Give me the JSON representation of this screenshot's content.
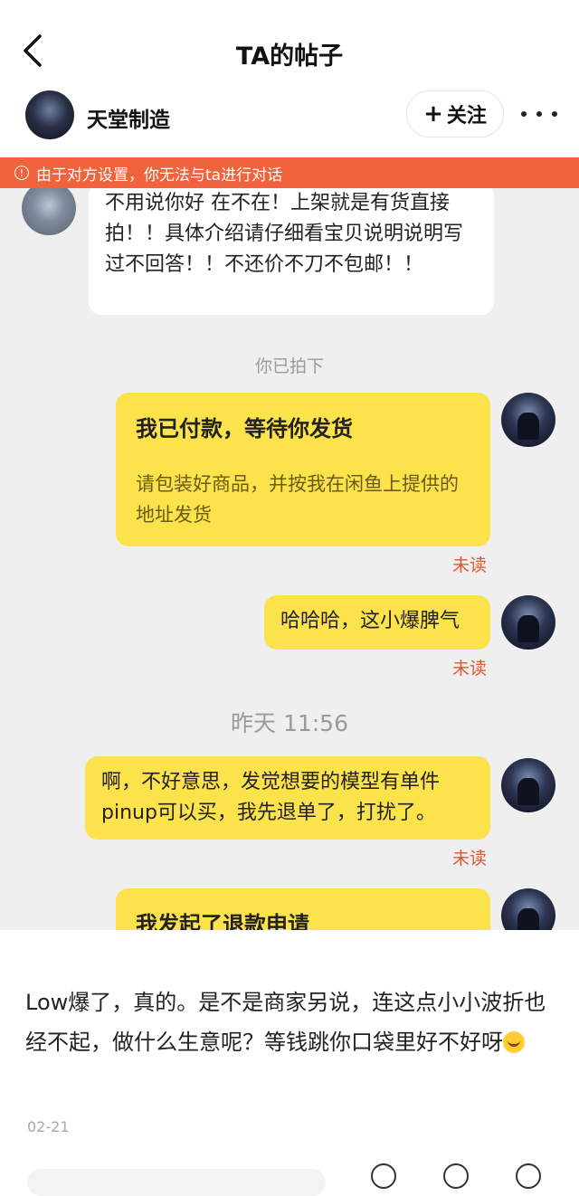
{
  "header": {
    "title": "TA的帖子"
  },
  "author": {
    "name": "天堂制造",
    "follow_label": "关注"
  },
  "chat": {
    "banner": "由于对方设置，你无法与ta进行对话",
    "seller_message": "不用说你好 在不在！上架就是有货直接拍！！具体介绍请仔细看宝贝说明说明写过不回答！！不还价不刀不包邮！！",
    "system_note": "你已拍下",
    "payment_card": {
      "title": "我已付款，等待你发货",
      "subtitle": "请包装好商品，并按我在闲鱼上提供的地址发货"
    },
    "unread_label": "未读",
    "msg_haha": "哈哈哈，这小爆脾气",
    "timestamp": "昨天 11:56",
    "msg_sorry": "啊，不好意思，发觉想要的模型有单件pinup可以买，我先退单了，打扰了。",
    "refund_card_title": "我发起了退款申请"
  },
  "post": {
    "text": "Low爆了，真的。是不是商家另说，连这点小小波折也经不起，做什么生意呢？等钱跳你口袋里好不好呀",
    "emoji": "grinning-sweat-emoji",
    "date": "02-21"
  },
  "colors": {
    "banner": "#f0633c",
    "bubble_yellow": "#fce24b",
    "unread": "#e0572a",
    "chat_bg": "#efefef"
  }
}
